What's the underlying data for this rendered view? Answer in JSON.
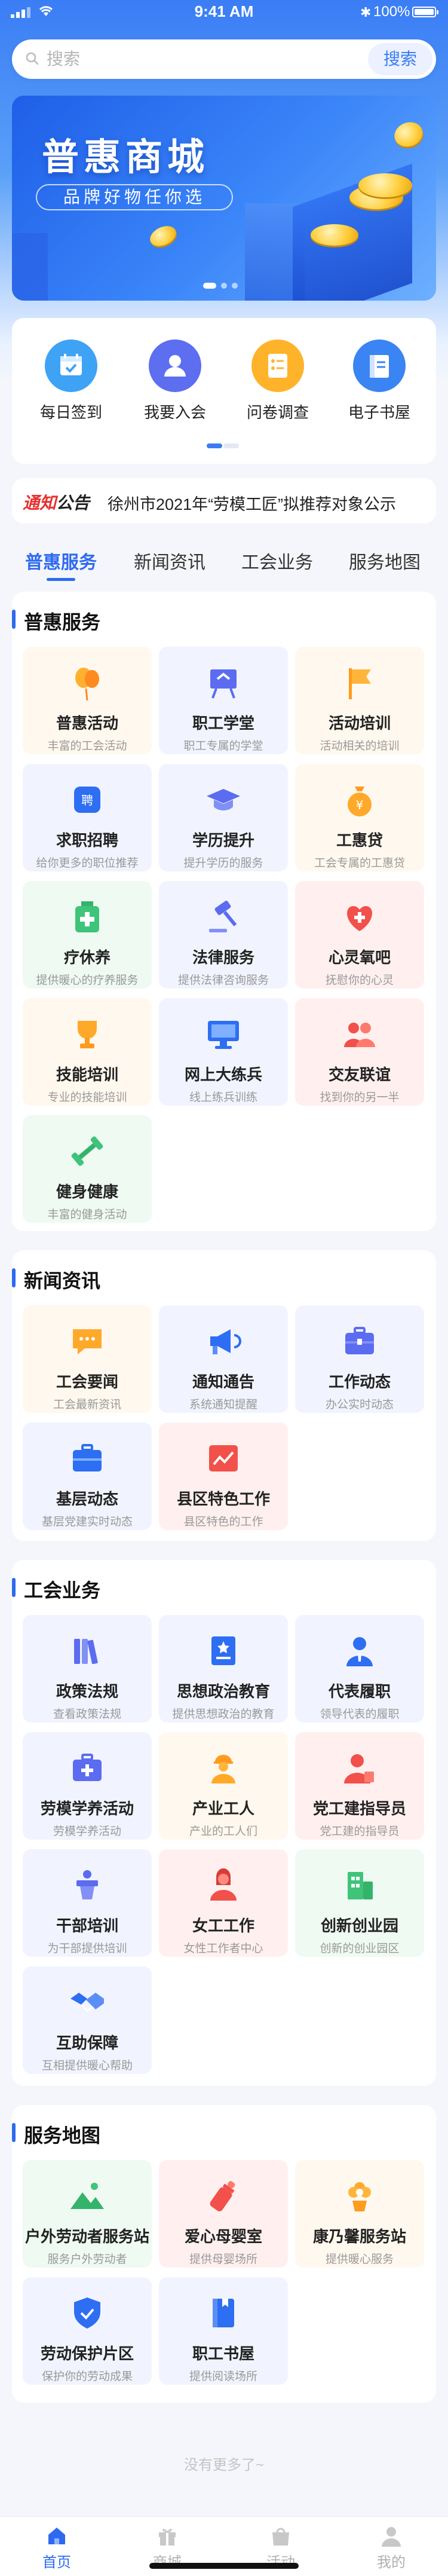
{
  "status_bar": {
    "time": "9:41 AM",
    "battery": "100%"
  },
  "search": {
    "placeholder": "搜索",
    "button": "搜索"
  },
  "banner": {
    "title": "普惠商城",
    "subtitle": "品牌好物任你选"
  },
  "quick_actions": [
    {
      "label": "每日签到",
      "icon": "calendar-icon",
      "color": "#3ea2f5"
    },
    {
      "label": "我要入会",
      "icon": "user-icon",
      "color": "#5d6ef0"
    },
    {
      "label": "问卷调查",
      "icon": "checklist-icon",
      "color": "#ffb32b"
    },
    {
      "label": "电子书屋",
      "icon": "book-icon",
      "color": "#3a84f3"
    }
  ],
  "notice": {
    "tag_a": "通知",
    "tag_b": "公告",
    "text": "徐州市2021年“劳模工匠”拟推荐对象公示"
  },
  "tabs": [
    "普惠服务",
    "新闻资讯",
    "工会业务",
    "服务地图"
  ],
  "sections": {
    "puhui": {
      "title": "普惠服务",
      "items": [
        {
          "name": "普惠活动",
          "sub": "丰富的工会活动"
        },
        {
          "name": "职工学堂",
          "sub": "职工专属的学堂"
        },
        {
          "name": "活动培训",
          "sub": "活动相关的培训"
        },
        {
          "name": "求职招聘",
          "sub": "给你更多的职位推荐"
        },
        {
          "name": "学历提升",
          "sub": "提升学历的服务"
        },
        {
          "name": "工惠贷",
          "sub": "工会专属的工惠贷"
        },
        {
          "name": "疗休养",
          "sub": "提供暖心的疗养服务"
        },
        {
          "name": "法律服务",
          "sub": "提供法律咨询服务"
        },
        {
          "name": "心灵氧吧",
          "sub": "抚慰你的心灵"
        },
        {
          "name": "技能培训",
          "sub": "专业的技能培训"
        },
        {
          "name": "网上大练兵",
          "sub": "线上练兵训练"
        },
        {
          "name": "交友联谊",
          "sub": "找到你的另一半"
        },
        {
          "name": "健身健康",
          "sub": "丰富的健身活动"
        }
      ]
    },
    "news": {
      "title": "新闻资讯",
      "items": [
        {
          "name": "工会要闻",
          "sub": "工会最新资讯"
        },
        {
          "name": "通知通告",
          "sub": "系统通知提醒"
        },
        {
          "name": "工作动态",
          "sub": "办公实时动态"
        },
        {
          "name": "基层动态",
          "sub": "基层党建实时动态"
        },
        {
          "name": "县区特色工作",
          "sub": "县区特色的工作"
        }
      ]
    },
    "union": {
      "title": "工会业务",
      "items": [
        {
          "name": "政策法规",
          "sub": "查看政策法规"
        },
        {
          "name": "思想政治教育",
          "sub": "提供思想政治的教育"
        },
        {
          "name": "代表履职",
          "sub": "领导代表的履职"
        },
        {
          "name": "劳模学养活动",
          "sub": "劳模学养活动"
        },
        {
          "name": "产业工人",
          "sub": "产业的工人们"
        },
        {
          "name": "党工建指导员",
          "sub": "党工建的指导员"
        },
        {
          "name": "干部培训",
          "sub": "为干部提供培训"
        },
        {
          "name": "女工工作",
          "sub": "女性工作者中心"
        },
        {
          "name": "创新创业园",
          "sub": "创新的创业园区"
        },
        {
          "name": "互助保障",
          "sub": "互相提供暖心帮助"
        }
      ]
    },
    "map": {
      "title": "服务地图",
      "items": [
        {
          "name": "户外劳动者服务站",
          "sub": "服务户外劳动者"
        },
        {
          "name": "爱心母婴室",
          "sub": "提供母婴场所"
        },
        {
          "name": "康乃馨服务站",
          "sub": "提供暖心服务"
        },
        {
          "name": "劳动保护片区",
          "sub": "保护你的劳动成果"
        },
        {
          "name": "职工书屋",
          "sub": "提供阅读场所"
        }
      ]
    }
  },
  "footer": {
    "no_more": "没有更多了~"
  },
  "tabbar": [
    {
      "label": "首页",
      "icon": "home-icon"
    },
    {
      "label": "商城",
      "icon": "gift-icon"
    },
    {
      "label": "活动",
      "icon": "bag-icon"
    },
    {
      "label": "我的",
      "icon": "profile-icon"
    }
  ],
  "colors": {
    "primary": "#2e6af0",
    "notice_red": "#e63030"
  }
}
